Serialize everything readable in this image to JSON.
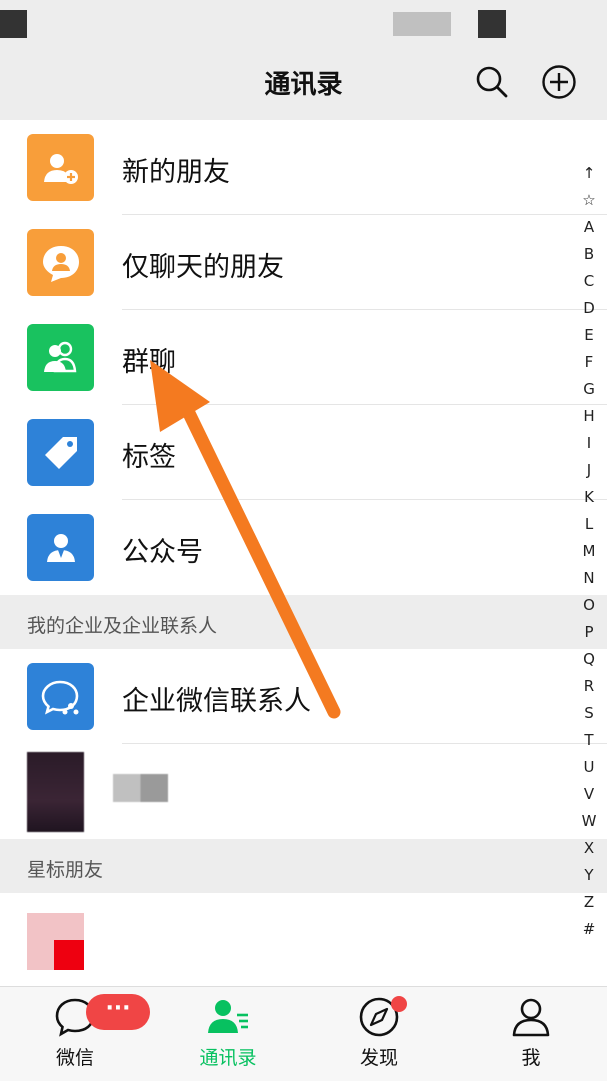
{
  "header": {
    "title": "通讯录"
  },
  "list": {
    "top_items": [
      {
        "label": "新的朋友",
        "icon": "add-friend-icon",
        "color": "#f89e3a"
      },
      {
        "label": "仅聊天的朋友",
        "icon": "chat-only-friend-icon",
        "color": "#f89e3a"
      },
      {
        "label": "群聊",
        "icon": "group-chat-icon",
        "color": "#19c25f"
      },
      {
        "label": "标签",
        "icon": "tag-icon",
        "color": "#2e82d8"
      },
      {
        "label": "公众号",
        "icon": "official-account-icon",
        "color": "#2e82d8"
      }
    ],
    "section_enterprise": {
      "title": "我的企业及企业联系人",
      "items": [
        {
          "label": "企业微信联系人",
          "icon": "wecom-contacts-icon",
          "color": "#2e82d8"
        }
      ]
    },
    "section_starred": {
      "title": "星标朋友"
    }
  },
  "index_bar": [
    "↑",
    "☆",
    "A",
    "B",
    "C",
    "D",
    "E",
    "F",
    "G",
    "H",
    "I",
    "J",
    "K",
    "L",
    "M",
    "N",
    "O",
    "P",
    "Q",
    "R",
    "S",
    "T",
    "U",
    "V",
    "W",
    "X",
    "Y",
    "Z",
    "#"
  ],
  "bottom_nav": {
    "items": [
      {
        "label": "微信",
        "icon": "chat-bubble-icon"
      },
      {
        "label": "通讯录",
        "icon": "contacts-icon",
        "active": true
      },
      {
        "label": "发现",
        "icon": "compass-icon"
      },
      {
        "label": "我",
        "icon": "person-icon"
      }
    ],
    "chat_badge": "···"
  },
  "colors": {
    "accent": "#07c160",
    "badge": "#f04545",
    "annotation_arrow": "#f47a20"
  }
}
